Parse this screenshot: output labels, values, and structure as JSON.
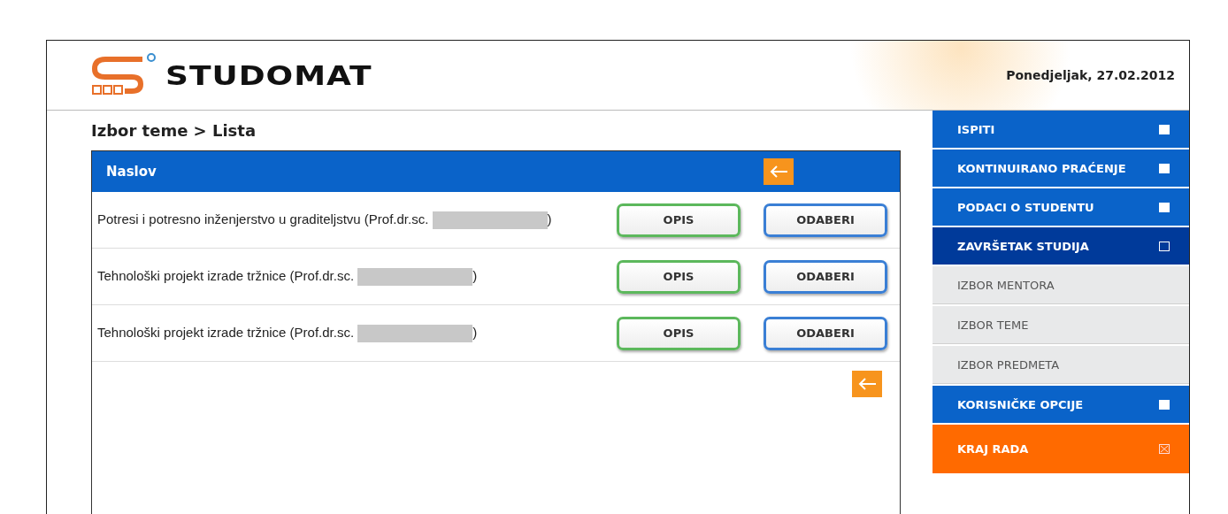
{
  "header": {
    "logo": "STUDOMAT",
    "date": "Ponedjeljak, 27.02.2012"
  },
  "breadcrumb": "Izbor teme > Lista",
  "table": {
    "column": "Naslov",
    "rows": [
      {
        "title": "Potresi i potresno inženjerstvo u graditeljstvu (Prof.dr.sc.",
        "closing": ")",
        "buttons": [
          {
            "label": "OPIS",
            "kind": "info"
          },
          {
            "label": "ODABERI",
            "kind": "select"
          }
        ]
      },
      {
        "title": "Tehnološki projekt izrade tržnice (Prof.dr.sc.",
        "closing": ")",
        "buttons": [
          {
            "label": "OPIS",
            "kind": "info"
          },
          {
            "label": "ODABERI",
            "kind": "select"
          }
        ]
      },
      {
        "title": "Tehnološki projekt izrade tržnice (Prof.dr.sc.",
        "closing": ")",
        "buttons": [
          {
            "label": "OPIS",
            "kind": "info"
          },
          {
            "label": "ODABERI",
            "kind": "select"
          }
        ]
      }
    ]
  },
  "sidebar": {
    "items": [
      {
        "label": "ISPITI",
        "kind": "section",
        "expanded": false
      },
      {
        "label": "KONTINUIRANO PRAĆENJE",
        "kind": "section",
        "expanded": false
      },
      {
        "label": "PODACI O STUDENTU",
        "kind": "section",
        "expanded": false
      },
      {
        "label": "ZAVRŠETAK STUDIJA",
        "kind": "section",
        "expanded": true,
        "children": [
          {
            "label": "IZBOR MENTORA"
          },
          {
            "label": "IZBOR TEME"
          },
          {
            "label": "IZBOR PREDMETA"
          }
        ]
      },
      {
        "label": "KORISNIČKE OPCIJE",
        "kind": "section",
        "expanded": false
      },
      {
        "label": "KRAJ RADA",
        "kind": "logout"
      }
    ]
  }
}
